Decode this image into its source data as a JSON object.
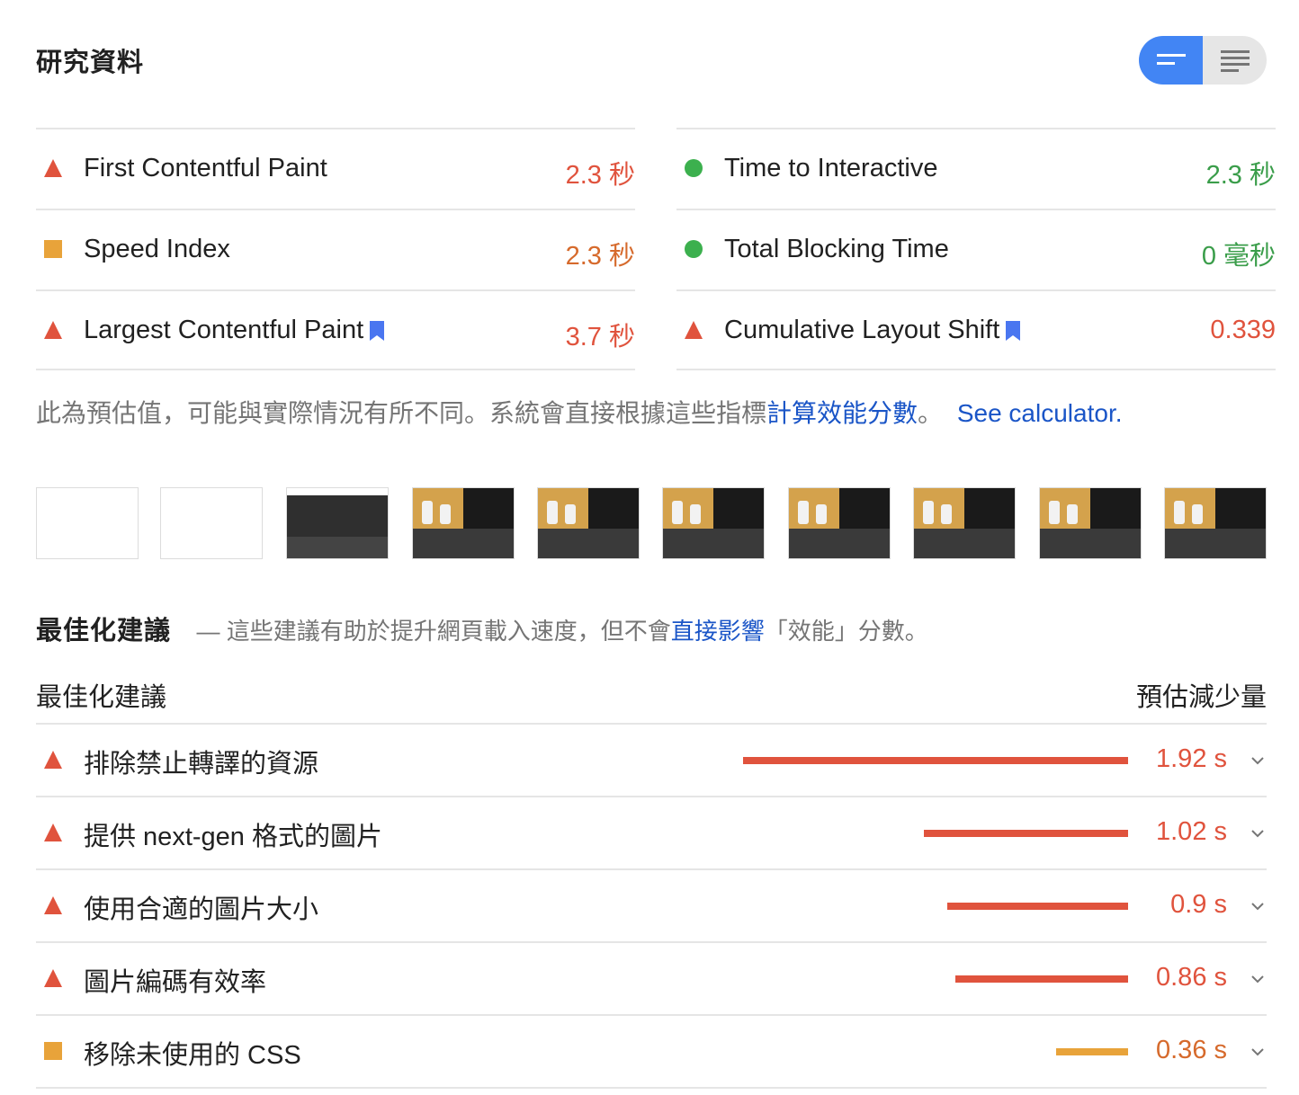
{
  "header": {
    "title": "研究資料"
  },
  "colors": {
    "fail": "#e0533d",
    "average": "#e8a33a",
    "pass": "#3a9d4a",
    "link": "#1a55c7",
    "accent": "#4285f4"
  },
  "metrics": {
    "left": [
      {
        "name": "First Contentful Paint",
        "value": "2.3 秒",
        "status": "fail",
        "icon": "red-triangle-icon",
        "bookmark": false
      },
      {
        "name": "Speed Index",
        "value": "2.3 秒",
        "status": "average",
        "icon": "orange-square-icon",
        "bookmark": false
      },
      {
        "name": "Largest Contentful Paint",
        "value": "3.7 秒",
        "status": "fail",
        "icon": "red-triangle-icon",
        "bookmark": true
      }
    ],
    "right": [
      {
        "name": "Time to Interactive",
        "value": "2.3 秒",
        "status": "pass",
        "icon": "green-circle-icon",
        "bookmark": false
      },
      {
        "name": "Total Blocking Time",
        "value": "0 毫秒",
        "status": "pass",
        "icon": "green-circle-icon",
        "bookmark": false
      },
      {
        "name": "Cumulative Layout Shift",
        "value": "0.339",
        "status": "fail",
        "icon": "red-triangle-icon",
        "bookmark": true
      }
    ]
  },
  "note": {
    "text": "此為預估值，可能與實際情況有所不同。系統會直接根據這些指標",
    "link_text": "計算效能分數",
    "suffix": "。",
    "calculator_link": "See calculator."
  },
  "opportunities": {
    "title": "最佳化建議",
    "desc_prefix": "— 這些建議有助於提升網頁載入速度，但不會",
    "desc_link": "直接影響",
    "desc_suffix": "「效能」分數。",
    "column_left": "最佳化建議",
    "column_right": "預估減少量",
    "items": [
      {
        "title": "排除禁止轉譯的資源",
        "value": "1.92 s",
        "seconds": 1.92,
        "status": "fail"
      },
      {
        "title": "提供 next-gen 格式的圖片",
        "value": "1.02 s",
        "seconds": 1.02,
        "status": "fail"
      },
      {
        "title": "使用合適的圖片大小",
        "value": "0.9 s",
        "seconds": 0.9,
        "status": "fail"
      },
      {
        "title": "圖片編碼有效率",
        "value": "0.86 s",
        "seconds": 0.86,
        "status": "fail"
      },
      {
        "title": "移除未使用的 CSS",
        "value": "0.36 s",
        "seconds": 0.36,
        "status": "average"
      }
    ]
  }
}
